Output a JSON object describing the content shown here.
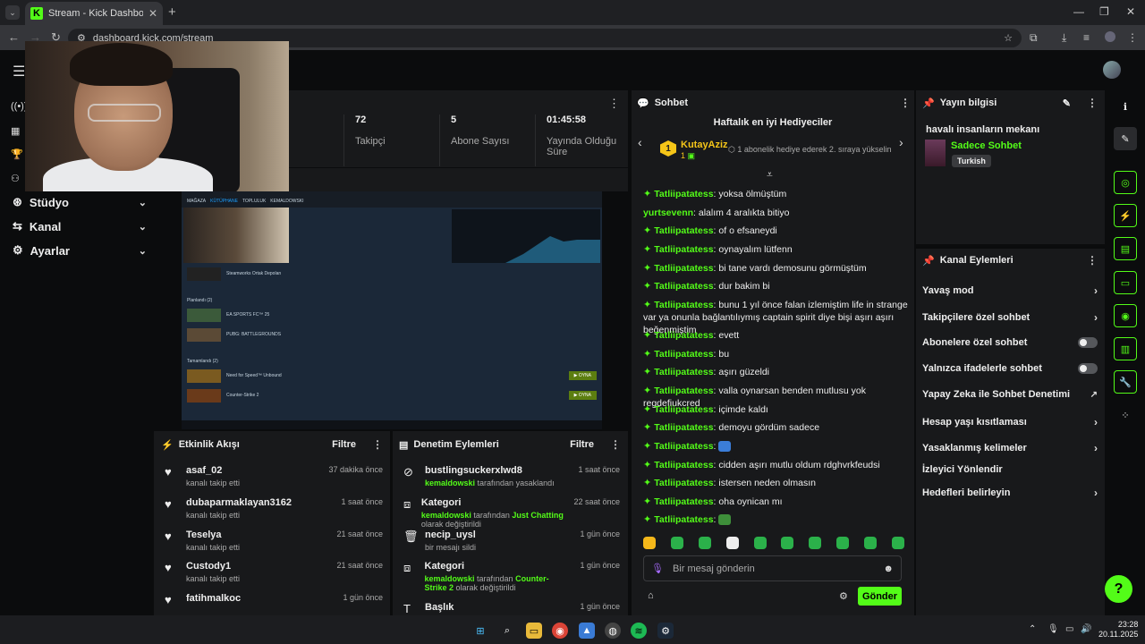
{
  "browser": {
    "tab_title": "Stream - Kick Dashboard",
    "tab_close": "✕",
    "new_tab": "+",
    "url": "dashboard.kick.com/stream"
  },
  "sidebar": {
    "items": [
      {
        "label": "Stüdyo"
      },
      {
        "label": "Kanal"
      },
      {
        "label": "Ayarlar"
      }
    ]
  },
  "stats": {
    "items": [
      {
        "value": "72",
        "label": "Takipçi"
      },
      {
        "value": "5",
        "label": "Abone Sayısı"
      },
      {
        "value": "01:45:58",
        "label": "Yayında Olduğu Süre"
      }
    ]
  },
  "preview": {
    "nav": [
      "MAĞAZA",
      "KÜTÜPHANE",
      "TOPLULUK",
      "KEMALDOWSKI"
    ],
    "rows": [
      {
        "name": "Steamworks Ortak Depoları",
        "btn": ""
      },
      {
        "name": "Planlandı (2)",
        "btn": ""
      },
      {
        "name": "EA SPORTS FC™ 25",
        "btn": ""
      },
      {
        "name": "PUBG: BATTLEGROUNDS",
        "btn": ""
      },
      {
        "name": "Tamamlandı (2)",
        "btn": ""
      },
      {
        "name": "Need for Speed™ Unbound",
        "btn": "▶ OYNA"
      },
      {
        "name": "Counter-Strike 2",
        "btn": "▶ OYNA"
      }
    ]
  },
  "activity": {
    "title": "Etkinlik Akışı",
    "filter": "Filtre",
    "events": [
      {
        "name": "asaf_02",
        "sub": "kanalı takip etti",
        "time": "37 dakika önce"
      },
      {
        "name": "dubaparmaklayan3162",
        "sub": "kanalı takip etti",
        "time": "1 saat önce"
      },
      {
        "name": "Teselya",
        "sub": "kanalı takip etti",
        "time": "21 saat önce"
      },
      {
        "name": "Custody1",
        "sub": "kanalı takip etti",
        "time": "21 saat önce"
      },
      {
        "name": "fatihmalkoc",
        "sub": "",
        "time": "1 gün önce"
      }
    ]
  },
  "moderation": {
    "title": "Denetim Eylemleri",
    "filter": "Filtre",
    "events": [
      {
        "name": "bustlingsuckerxlwd8",
        "mod": "kemaldowski",
        "text": " tarafından yasaklandı",
        "extra": "",
        "tail": "",
        "time": "1 saat önce"
      },
      {
        "name": "Kategori",
        "mod": "kemaldowski",
        "text": " tarafından ",
        "extra": "Just Chatting",
        "tail": " olarak değiştirildi",
        "time": "22 saat önce"
      },
      {
        "name": "necip_uysl",
        "mod": "",
        "text": "bir mesajı sildi",
        "extra": "",
        "tail": "",
        "time": "1 gün önce"
      },
      {
        "name": "Kategori",
        "mod": "kemaldowski",
        "text": " tarafından ",
        "extra": "Counter-Strike 2",
        "tail": " olarak değiştirildi",
        "time": "1 gün önce"
      },
      {
        "name": "Başlık",
        "mod": "",
        "text": "",
        "extra": "",
        "tail": "",
        "time": "1 gün önce"
      }
    ]
  },
  "chat": {
    "title": "Sohbet",
    "gift_title": "Haftalık en iyi Hediyeciler",
    "gift_user": "KutayAziz",
    "gift_rank": "1",
    "gift_count": "1",
    "gift_hint": "1 abonelik hediye ederek 2. sıraya yükselin",
    "messages": [
      {
        "user": "Tatliipatatess",
        "text": "yoksa ölmüştüm",
        "badge": true
      },
      {
        "user": "yurtsevenn",
        "text": "alalım 4 aralıkta bitiyo",
        "badge": false
      },
      {
        "user": "Tatliipatatess",
        "text": "of o efsaneydi",
        "badge": true
      },
      {
        "user": "Tatliipatatess",
        "text": "oynayalım lütfenn",
        "badge": true
      },
      {
        "user": "Tatliipatatess",
        "text": "bi tane vardı demosunu görmüştüm",
        "badge": true
      },
      {
        "user": "Tatliipatatess",
        "text": "dur bakim bi",
        "badge": true
      },
      {
        "user": "Tatliipatatess",
        "text": "bunu 1 yıl önce falan izlemiştim life in strange var ya onunla bağlantılıymış captain spirit diye bişi aşırı aşırı beğenmiştim",
        "badge": true
      },
      {
        "user": "Tatliipatatess",
        "text": "evett",
        "badge": true
      },
      {
        "user": "Tatliipatatess",
        "text": "bu",
        "badge": true
      },
      {
        "user": "Tatliipatatess",
        "text": "aşırı güzeldi",
        "badge": true
      },
      {
        "user": "Tatliipatatess",
        "text": "valla oynarsan benden mutlusu yok regdefiukcred",
        "badge": true
      },
      {
        "user": "Tatliipatatess",
        "text": "içimde kaldı",
        "badge": true
      },
      {
        "user": "Tatliipatatess",
        "text": "demoyu gördüm sadece",
        "badge": true
      },
      {
        "user": "Tatliipatatess",
        "text": "",
        "badge": true,
        "emote": "#3b7dd8"
      },
      {
        "user": "Tatliipatatess",
        "text": "cidden aşırı mutlu oldum rdghvrkfeudsi",
        "badge": true
      },
      {
        "user": "Tatliipatatess",
        "text": "istersen neden olmasın",
        "badge": true
      },
      {
        "user": "Tatliipatatess",
        "text": "oha oynican mı",
        "badge": true
      },
      {
        "user": "Tatliipatatess",
        "text": "",
        "badge": true,
        "emote": "#3e8f3a"
      }
    ],
    "input_placeholder": "Bir mesaj gönderin",
    "send_label": "Gönder"
  },
  "stream_info": {
    "title": "Yayın bilgisi",
    "stream_title": "havalı insanların mekanı",
    "category": "Sadece Sohbet",
    "language": "Turkish"
  },
  "channel_actions": {
    "title": "Kanal Eylemleri",
    "items": [
      {
        "label": "Yavaş mod",
        "type": "chevron"
      },
      {
        "label": "Takipçilere özel sohbet",
        "type": "chevron"
      },
      {
        "label": "Abonelere özel sohbet",
        "type": "toggle"
      },
      {
        "label": "Yalnızca ifadelerle sohbet",
        "type": "toggle"
      },
      {
        "label": "Yapay Zeka ile Sohbet Denetimi",
        "type": "external"
      },
      {
        "label": "Hesap yaşı kısıtlaması",
        "type": "chevron"
      },
      {
        "label": "Yasaklanmış kelimeler",
        "type": "chevron"
      },
      {
        "label": "İzleyici Yönlendir",
        "type": "none"
      },
      {
        "label": "Hedefleri belirleyin",
        "type": "chevron"
      }
    ]
  },
  "taskbar": {
    "time": "23:28",
    "date": "20.11.2025"
  },
  "colors": {
    "accent": "#53fc18",
    "panel": "#18191b",
    "background": "#0b0c0d"
  }
}
